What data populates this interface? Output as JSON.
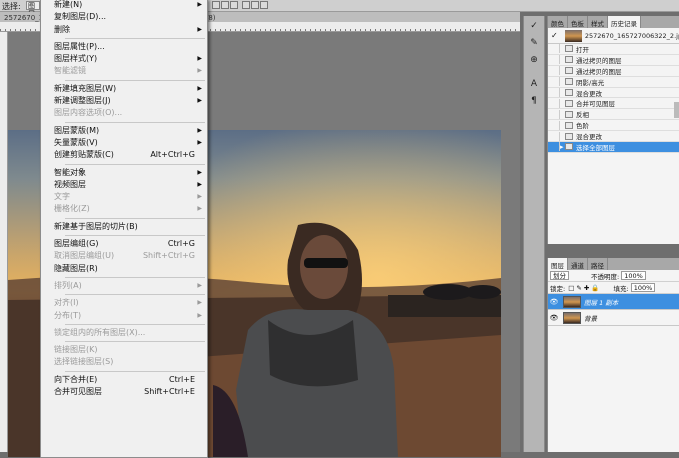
{
  "options_bar": {
    "label": "选择:",
    "field": "图层"
  },
  "document": {
    "tab_title": "2572670_165727006322_2.jpg @ 100% (图层 1 副本, RGB/8)"
  },
  "context_menu": {
    "items": [
      {
        "label": "新建(N)",
        "shortcut": "",
        "submenu": true,
        "disabled": false
      },
      {
        "label": "复制图层(D)...",
        "shortcut": "",
        "submenu": false,
        "disabled": false
      },
      {
        "label": "删除",
        "shortcut": "",
        "submenu": true,
        "disabled": false
      },
      {
        "sep": true
      },
      {
        "label": "图层属性(P)...",
        "shortcut": "",
        "submenu": false,
        "disabled": false
      },
      {
        "label": "图层样式(Y)",
        "shortcut": "",
        "submenu": true,
        "disabled": false
      },
      {
        "label": "智能滤镜",
        "shortcut": "",
        "submenu": true,
        "disabled": true
      },
      {
        "sep": true
      },
      {
        "label": "新建填充图层(W)",
        "shortcut": "",
        "submenu": true,
        "disabled": false
      },
      {
        "label": "新建调整图层(J)",
        "shortcut": "",
        "submenu": true,
        "disabled": false
      },
      {
        "label": "图层内容选项(O)...",
        "shortcut": "",
        "submenu": false,
        "disabled": true
      },
      {
        "sep": true
      },
      {
        "label": "图层蒙版(M)",
        "shortcut": "",
        "submenu": true,
        "disabled": false
      },
      {
        "label": "矢量蒙版(V)",
        "shortcut": "",
        "submenu": true,
        "disabled": false
      },
      {
        "label": "创建剪贴蒙版(C)",
        "shortcut": "Alt+Ctrl+G",
        "submenu": false,
        "disabled": false
      },
      {
        "sep": true
      },
      {
        "label": "智能对象",
        "shortcut": "",
        "submenu": true,
        "disabled": false
      },
      {
        "label": "视频图层",
        "shortcut": "",
        "submenu": true,
        "disabled": false
      },
      {
        "label": "文字",
        "shortcut": "",
        "submenu": true,
        "disabled": true
      },
      {
        "label": "栅格化(Z)",
        "shortcut": "",
        "submenu": true,
        "disabled": true
      },
      {
        "sep": true
      },
      {
        "label": "新建基于图层的切片(B)",
        "shortcut": "",
        "submenu": false,
        "disabled": false
      },
      {
        "sep": true
      },
      {
        "label": "图层编组(G)",
        "shortcut": "Ctrl+G",
        "submenu": false,
        "disabled": false
      },
      {
        "label": "取消图层编组(U)",
        "shortcut": "Shift+Ctrl+G",
        "submenu": false,
        "disabled": true
      },
      {
        "label": "隐藏图层(R)",
        "shortcut": "",
        "submenu": false,
        "disabled": false
      },
      {
        "sep": true
      },
      {
        "label": "排列(A)",
        "shortcut": "",
        "submenu": true,
        "disabled": true
      },
      {
        "sep": true
      },
      {
        "label": "对齐(I)",
        "shortcut": "",
        "submenu": true,
        "disabled": true
      },
      {
        "label": "分布(T)",
        "shortcut": "",
        "submenu": true,
        "disabled": true
      },
      {
        "sep": true
      },
      {
        "label": "锁定组内的所有图层(X)...",
        "shortcut": "",
        "submenu": false,
        "disabled": true
      },
      {
        "sep": true
      },
      {
        "label": "链接图层(K)",
        "shortcut": "",
        "submenu": false,
        "disabled": true
      },
      {
        "label": "选择链接图层(S)",
        "shortcut": "",
        "submenu": false,
        "disabled": true
      },
      {
        "sep": true
      },
      {
        "label": "向下合并(E)",
        "shortcut": "Ctrl+E",
        "submenu": false,
        "disabled": false
      },
      {
        "label": "合并可见图层",
        "shortcut": "Shift+Ctrl+E",
        "submenu": false,
        "disabled": false
      }
    ]
  },
  "history_panel": {
    "tabs": [
      "颜色",
      "色板",
      "样式",
      "历史记录"
    ],
    "active_tab": "历史记录",
    "snapshot": "2572670_165727006322_2.jpg",
    "items": [
      "打开",
      "通过拷贝的图层",
      "通过拷贝的图层",
      "阴影/高光",
      "混合更改",
      "合并可见图层",
      "反相",
      "色阶",
      "混合更改",
      "选择全部图层"
    ],
    "active_index": 9
  },
  "layers_panel": {
    "tabs": [
      "图层",
      "通道",
      "路径"
    ],
    "blend_mode": "划分",
    "opacity_label": "不透明度:",
    "opacity_value": "100%",
    "lock_label": "锁定:",
    "fill_label": "填充:",
    "fill_value": "100%",
    "layers": [
      {
        "name": "图层 1 副本",
        "active": true
      },
      {
        "name": "背景",
        "active": false
      }
    ]
  },
  "tool_icons": [
    "history-brush-icon",
    "brush-settings-icon",
    "clone-source-icon",
    "character-icon",
    "paragraph-icon"
  ],
  "colors": {
    "highlight": "#3d8fe0",
    "menu_bg": "#f0f0f0",
    "disabled_text": "#9a9a9a"
  }
}
